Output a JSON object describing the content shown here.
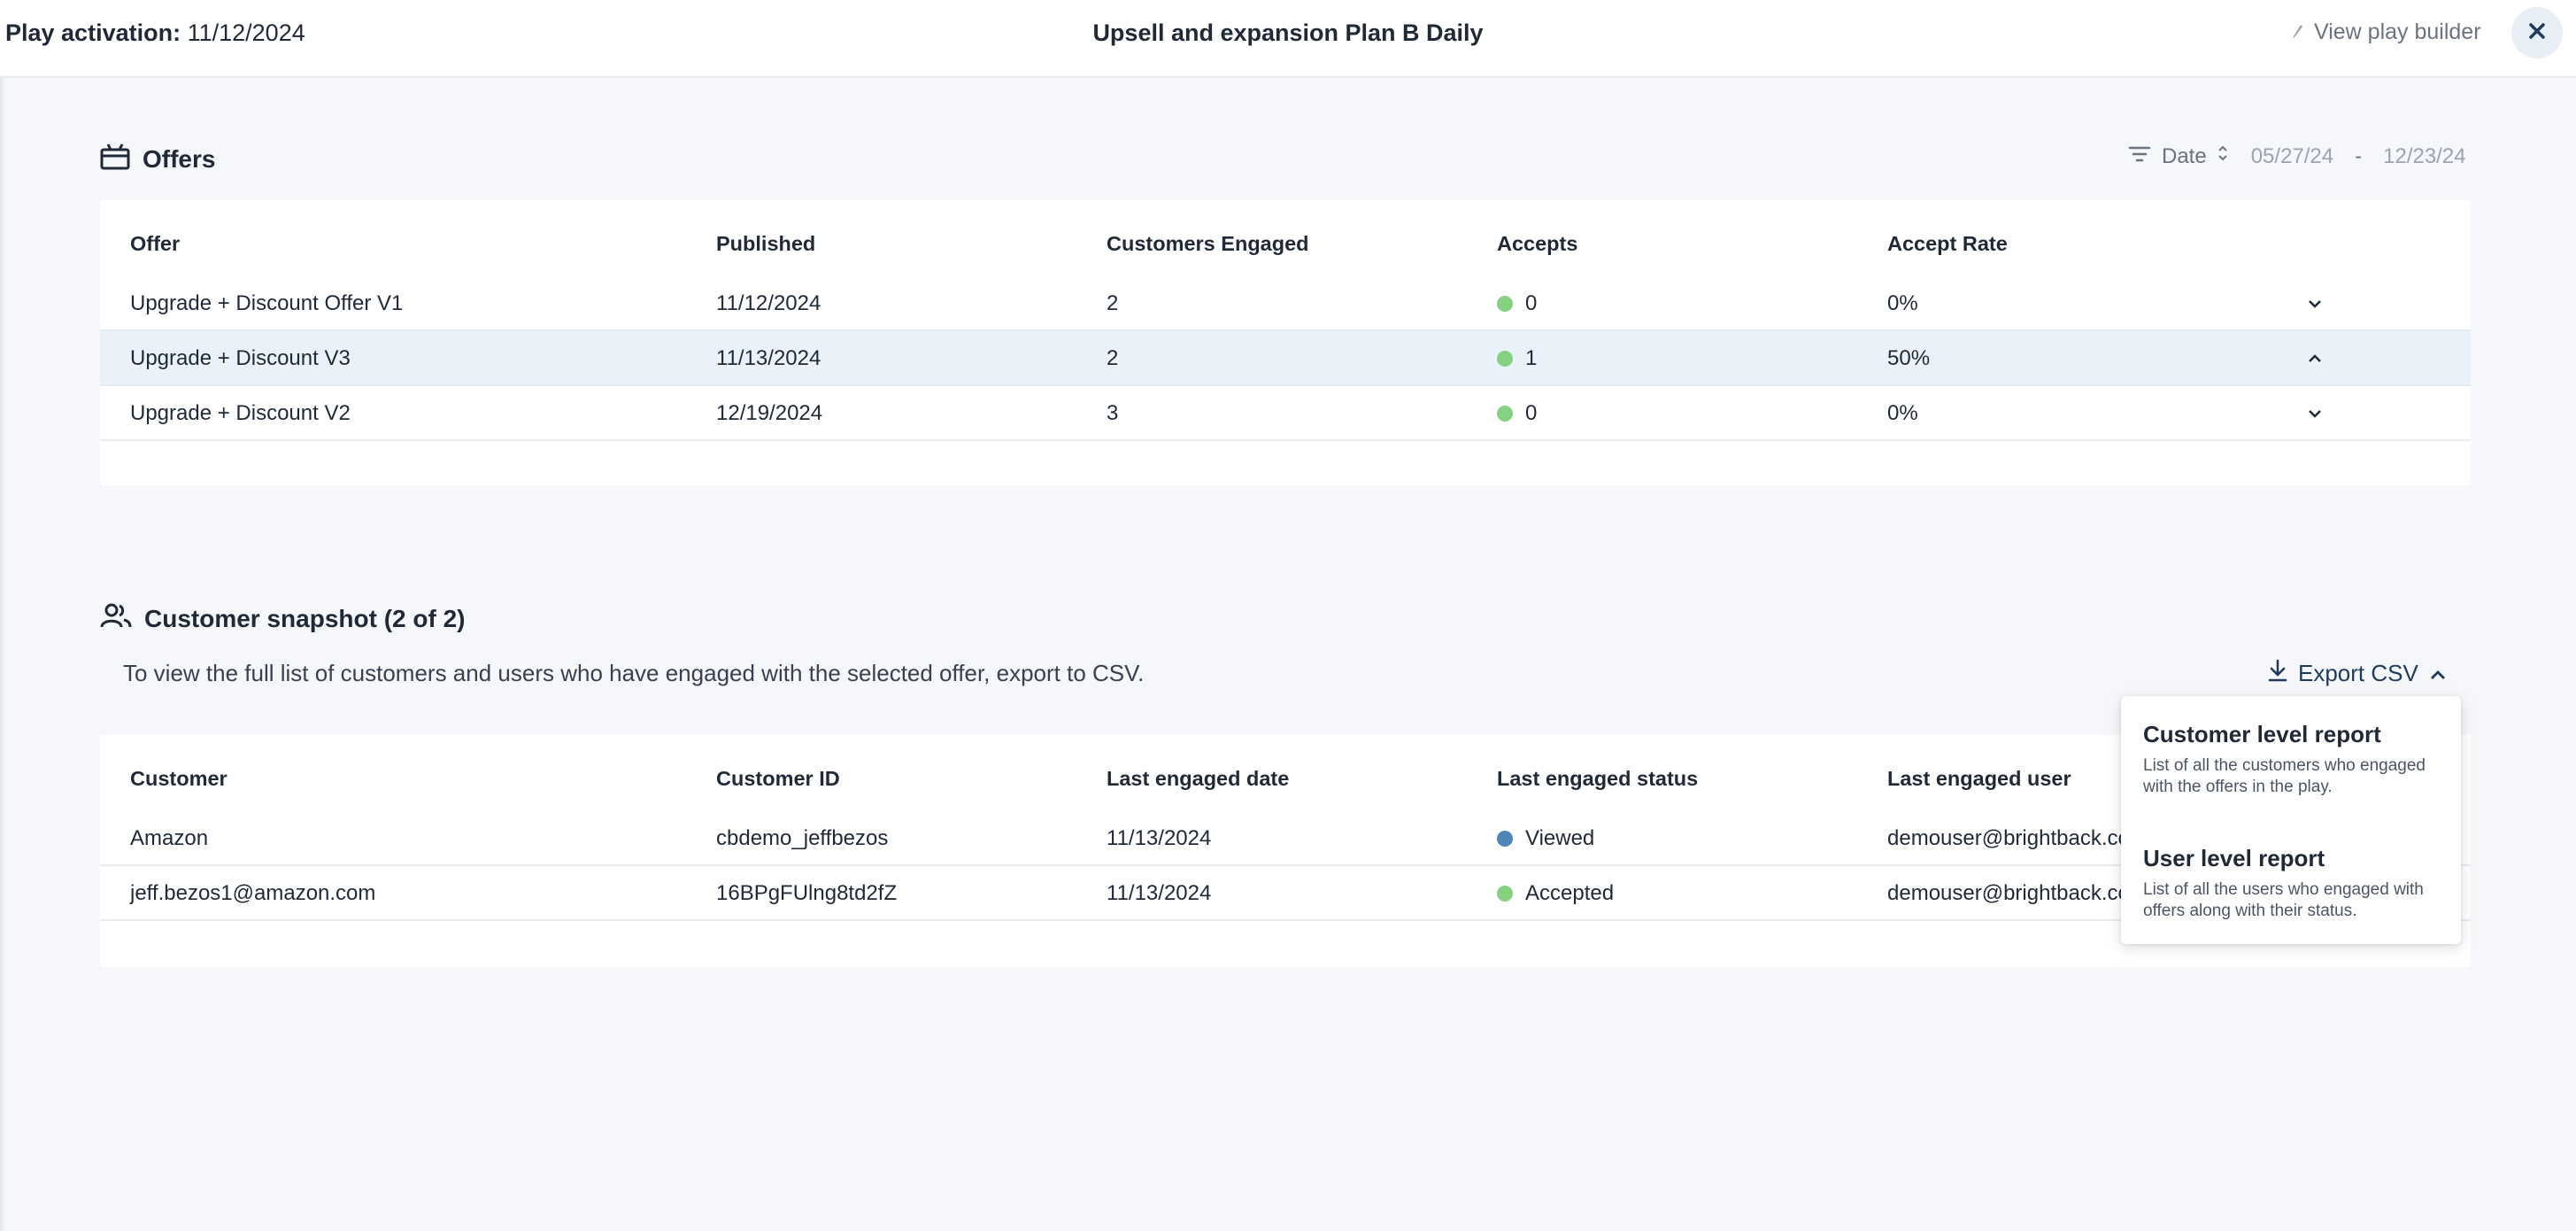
{
  "header": {
    "activation_label": "Play activation:",
    "activation_date": "11/12/2024",
    "title": "Upsell and expansion Plan B Daily",
    "view_builder": "View play builder"
  },
  "offers": {
    "title": "Offers",
    "filter_label": "Date",
    "date_from": "05/27/24",
    "date_sep": "-",
    "date_to": "12/23/24",
    "columns": [
      "Offer",
      "Published",
      "Customers Engaged",
      "Accepts",
      "Accept Rate"
    ],
    "rows": [
      {
        "offer": "Upgrade + Discount Offer V1",
        "published": "11/12/2024",
        "engaged": "2",
        "accepts": "0",
        "rate": "0%",
        "expanded": false
      },
      {
        "offer": "Upgrade + Discount V3",
        "published": "11/13/2024",
        "engaged": "2",
        "accepts": "1",
        "rate": "50%",
        "expanded": true
      },
      {
        "offer": "Upgrade + Discount V2",
        "published": "12/19/2024",
        "engaged": "3",
        "accepts": "0",
        "rate": "0%",
        "expanded": false
      }
    ]
  },
  "snapshot": {
    "title": "Customer snapshot (2 of 2)",
    "description": "To view the full list of customers and users who have engaged with the selected offer, export to CSV.",
    "export_label": "Export CSV",
    "columns": [
      "Customer",
      "Customer ID",
      "Last engaged date",
      "Last engaged status",
      "Last engaged user"
    ],
    "rows": [
      {
        "customer": "Amazon",
        "id": "cbdemo_jeffbezos",
        "date": "11/13/2024",
        "status": "Viewed",
        "user": "demouser@brightback.co"
      },
      {
        "customer": "jeff.bezos1@amazon.com",
        "id": "16BPgFUlng8td2fZ",
        "date": "11/13/2024",
        "status": "Accepted",
        "user": "demouser@brightback.co"
      }
    ]
  },
  "export_menu": {
    "items": [
      {
        "title": "Customer level report",
        "desc": "List of all the customers who engaged with the offers in the play."
      },
      {
        "title": "User level report",
        "desc": "List of all the users who engaged with offers along with their status."
      }
    ]
  },
  "colors": {
    "accepted_dot": "#86d17f",
    "viewed_dot": "#4e86b8",
    "selected_row": "#e8f2f8"
  }
}
